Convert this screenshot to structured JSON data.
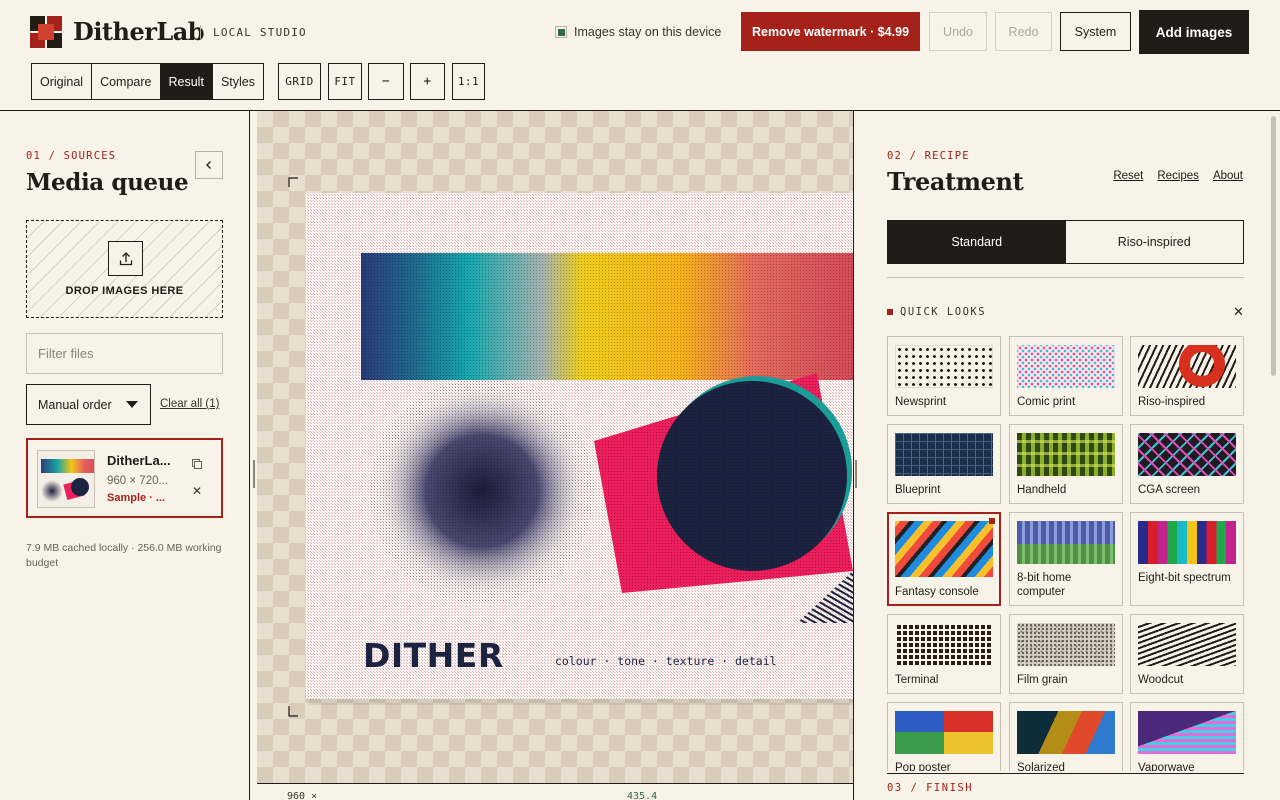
{
  "header": {
    "brand": "DitherLab",
    "brand_sub": "LOCAL STUDIO",
    "privacy": "Images stay on this device",
    "watermark_btn": "Remove watermark · $4.99",
    "undo": "Undo",
    "redo": "Redo",
    "system": "System",
    "add_images": "Add images",
    "view_tabs": [
      "Original",
      "Compare",
      "Result",
      "Styles"
    ],
    "active_view": "Result",
    "tools": {
      "grid": "GRID",
      "fit": "FIT",
      "zoom_out": "−",
      "zoom_in": "+",
      "actual": "1:1"
    }
  },
  "sources": {
    "eyebrow": "01 / SOURCES",
    "title": "Media queue",
    "drop_label": "DROP IMAGES HERE",
    "filter_placeholder": "Filter files",
    "sort": "Manual order",
    "clear_all": "Clear all (1)",
    "file": {
      "name": "DitherLa...",
      "dims": "960 × 720...",
      "tag": "Sample · ..."
    },
    "cache_note": "7.9 MB cached locally · 256.0 MB working budget"
  },
  "canvas": {
    "poster_title": "DITHER",
    "poster_tagline": "colour · tone · texture · detail",
    "footer_dims": "960 ×",
    "footer_zoom": "435.4"
  },
  "recipe": {
    "eyebrow": "02 / RECIPE",
    "title": "Treatment",
    "links": [
      "Reset",
      "Recipes",
      "About"
    ],
    "modes": [
      "Standard",
      "Riso-inspired"
    ],
    "active_mode": "Standard",
    "quick_looks_label": "QUICK LOOKS",
    "looks": [
      {
        "label": "Newsprint",
        "icon": "newsprint-swatch"
      },
      {
        "label": "Comic print",
        "icon": "comic-swatch"
      },
      {
        "label": "Riso-inspired",
        "icon": "riso-swatch"
      },
      {
        "label": "Blueprint",
        "icon": "blueprint-swatch"
      },
      {
        "label": "Handheld",
        "icon": "handheld-swatch"
      },
      {
        "label": "CGA screen",
        "icon": "cga-swatch"
      },
      {
        "label": "Fantasy console",
        "icon": "fantasy-swatch"
      },
      {
        "label": "8-bit home computer",
        "icon": "8bit-swatch"
      },
      {
        "label": "Eight-bit spectrum",
        "icon": "spectrum-swatch"
      },
      {
        "label": "Terminal",
        "icon": "terminal-swatch"
      },
      {
        "label": "Film grain",
        "icon": "film-grain-swatch"
      },
      {
        "label": "Woodcut",
        "icon": "woodcut-swatch"
      },
      {
        "label": "Pop poster",
        "icon": "pop-swatch"
      },
      {
        "label": "Solarized",
        "icon": "solarized-swatch"
      },
      {
        "label": "Vaporwave",
        "icon": "vaporwave-swatch"
      }
    ],
    "selected_look": "Fantasy console",
    "finish_eyebrow": "03 / FINISH"
  },
  "colors": {
    "accent": "#a5221a",
    "ink": "#231b15",
    "paper": "#f8f3e8",
    "ok": "#2f6b45"
  }
}
